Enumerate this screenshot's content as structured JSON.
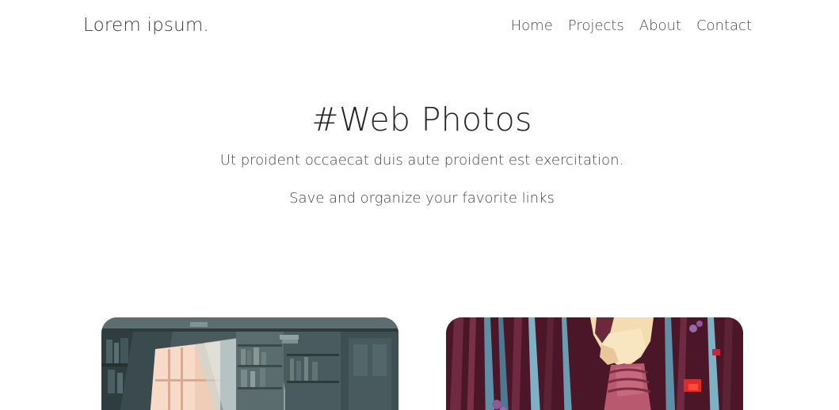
{
  "header": {
    "brand": "Lorem ipsum.",
    "nav": [
      "Home",
      "Projects",
      "About",
      "Contact"
    ]
  },
  "hero": {
    "title": "#Web Photos",
    "subtitle": "Ut proident occaecat duis aute proident est exercitation.",
    "tagline": "Save and organize your favorite links"
  },
  "cards": [
    {
      "image": "library-window-illustration"
    },
    {
      "image": "forest-figure-illustration"
    }
  ],
  "colors": {
    "text": "#2d2d2d",
    "background": "#ffffff"
  }
}
